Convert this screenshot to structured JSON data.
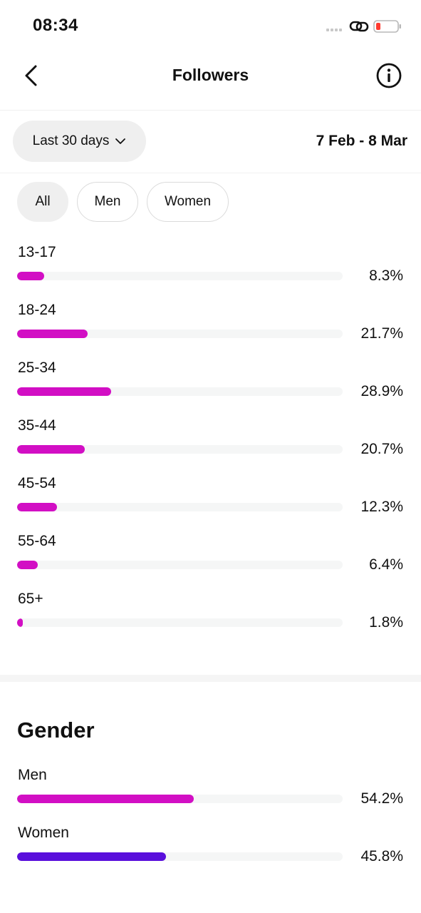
{
  "status_bar": {
    "time": "08:34"
  },
  "nav": {
    "title": "Followers"
  },
  "filters": {
    "range_label": "Last 30 days",
    "date_range": "7 Feb - 8 Mar"
  },
  "segments": [
    {
      "label": "All",
      "active": true
    },
    {
      "label": "Men",
      "active": false
    },
    {
      "label": "Women",
      "active": false
    }
  ],
  "age_ranges": [
    {
      "label": "13-17",
      "value": 8.3,
      "display": "8.3%"
    },
    {
      "label": "18-24",
      "value": 21.7,
      "display": "21.7%"
    },
    {
      "label": "25-34",
      "value": 28.9,
      "display": "28.9%"
    },
    {
      "label": "35-44",
      "value": 20.7,
      "display": "20.7%"
    },
    {
      "label": "45-54",
      "value": 12.3,
      "display": "12.3%"
    },
    {
      "label": "55-64",
      "value": 6.4,
      "display": "6.4%"
    },
    {
      "label": "65+",
      "value": 1.8,
      "display": "1.8%"
    }
  ],
  "gender": {
    "title": "Gender",
    "items": [
      {
        "label": "Men",
        "value": 54.2,
        "display": "54.2%",
        "color": "#d20fc4"
      },
      {
        "label": "Women",
        "value": 45.8,
        "display": "45.8%",
        "color": "#5a0fdc"
      }
    ]
  },
  "colors": {
    "age_bar": "#d20fc4",
    "track": "#f5f6f6",
    "battery_low": "#ff3b30"
  }
}
